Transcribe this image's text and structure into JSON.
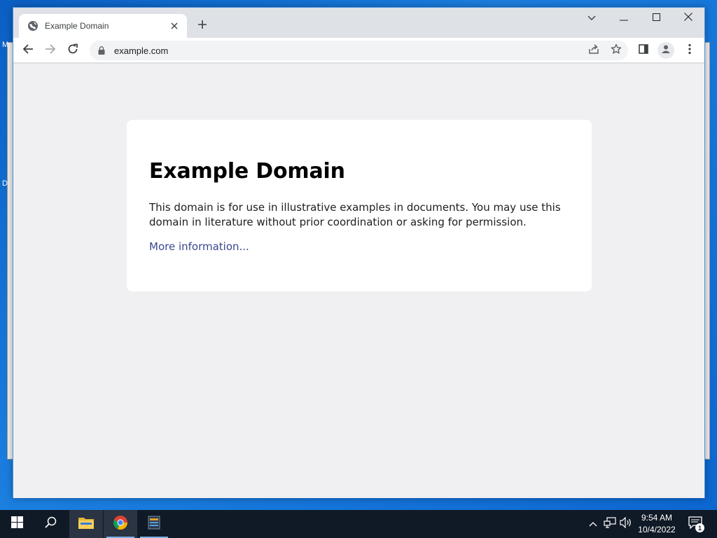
{
  "desktop": {
    "fragment_left_top": "M",
    "fragment_left_mid": "D"
  },
  "browser": {
    "tab": {
      "title": "Example Domain",
      "favicon": "globe-icon",
      "close": "close-icon"
    },
    "new_tab": "plus-icon",
    "window_controls": [
      "chevron-down-icon",
      "minimize-icon",
      "maximize-icon",
      "close-icon"
    ],
    "toolbar": {
      "back": "arrow-left-icon",
      "forward": "arrow-right-icon",
      "reload": "reload-icon",
      "url": "example.com",
      "lock": "lock-icon",
      "share": "share-icon",
      "bookmark": "star-icon",
      "side_panel": "side-panel-icon",
      "profile": "person-icon",
      "menu": "kebab-icon"
    }
  },
  "page": {
    "heading": "Example Domain",
    "body": "This domain is for use in illustrative examples in documents. You may use this domain in literature without prior coordination or asking for permission.",
    "link": "More information..."
  },
  "taskbar": {
    "start": "windows-logo-icon",
    "search": "search-icon",
    "apps": [
      "file-explorer-icon",
      "chrome-icon",
      "app-icon"
    ],
    "tray": [
      "chevron-up-icon",
      "network-icon",
      "speaker-icon"
    ],
    "time": "9:54 AM",
    "date": "10/4/2022",
    "notification_count": "1"
  },
  "colors": {
    "link": "#38488f",
    "page_bg": "#f0f0f2",
    "taskbar_bg": "#101a26",
    "desktop_bg": "#1b7fe0"
  }
}
